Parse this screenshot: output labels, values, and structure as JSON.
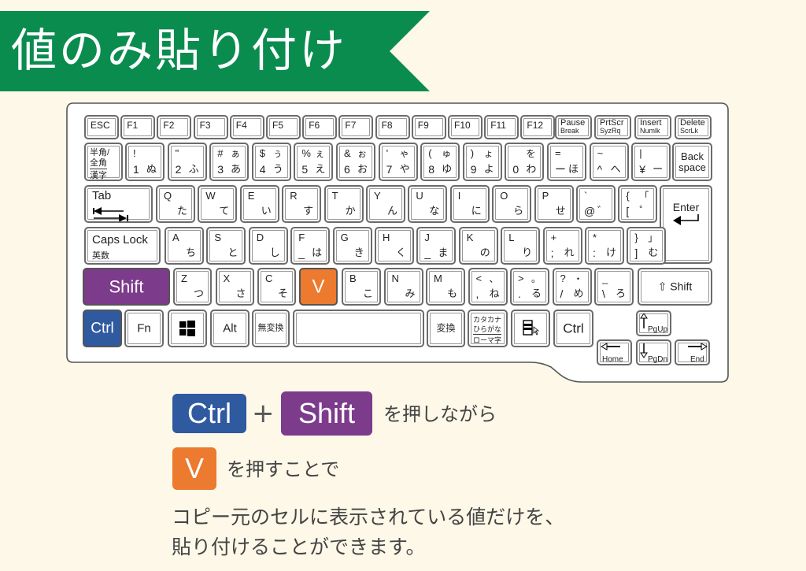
{
  "title": "値のみ貼り付け",
  "colors": {
    "banner": "#0a8c4f",
    "background": "#fdf8e8",
    "ctrl": "#2f5aa0",
    "shift": "#7d3b8c",
    "v": "#ec7a2f"
  },
  "keyboard": {
    "function_row": [
      "ESC",
      "F1",
      "F2",
      "F3",
      "F4",
      "F5",
      "F6",
      "F7",
      "F8",
      "F9",
      "F10",
      "F11",
      "F12"
    ],
    "pause": {
      "top": "Pause",
      "bottom": "Break"
    },
    "prtscr": {
      "top": "PrtScr",
      "bottom": "SyzRq"
    },
    "insert": {
      "top": "Insert",
      "bottom": "Numlk"
    },
    "delete": {
      "top": "Delete",
      "bottom": "ScrLk"
    },
    "hankaku": {
      "l1": "半角/",
      "l2": "全角",
      "l3": "漢字"
    },
    "number_row": [
      {
        "tl": "!",
        "tr": "",
        "bl": "1",
        "br": "ぬ"
      },
      {
        "tl": "\"",
        "tr": "",
        "bl": "2",
        "br": "ふ"
      },
      {
        "tl": "#",
        "tr": "ぁ",
        "bl": "3",
        "br": "あ"
      },
      {
        "tl": "$",
        "tr": "ぅ",
        "bl": "4",
        "br": "う"
      },
      {
        "tl": "%",
        "tr": "ぇ",
        "bl": "5",
        "br": "え"
      },
      {
        "tl": "&",
        "tr": "ぉ",
        "bl": "6",
        "br": "お"
      },
      {
        "tl": "'",
        "tr": "ゃ",
        "bl": "7",
        "br": "や"
      },
      {
        "tl": "(",
        "tr": "ゅ",
        "bl": "8",
        "br": "ゆ"
      },
      {
        "tl": ")",
        "tr": "ょ",
        "bl": "9",
        "br": "よ"
      },
      {
        "tl": "",
        "tr": "を",
        "bl": "0",
        "br": "わ"
      },
      {
        "tl": "=",
        "tr": "",
        "bl": "ー",
        "br": "ほ"
      },
      {
        "tl": "~",
        "tr": "",
        "bl": "^",
        "br": "へ"
      },
      {
        "tl": "|",
        "tr": "",
        "bl": "¥",
        "br": "ー"
      }
    ],
    "backspace": {
      "l1": "Back",
      "l2": "space"
    },
    "tab": "Tab",
    "q_row": [
      {
        "tl": "Q",
        "br": "た"
      },
      {
        "tl": "W",
        "br": "て"
      },
      {
        "tl": "E",
        "br": "い"
      },
      {
        "tl": "R",
        "br": "す"
      },
      {
        "tl": "T",
        "br": "か"
      },
      {
        "tl": "Y",
        "br": "ん"
      },
      {
        "tl": "U",
        "br": "な"
      },
      {
        "tl": "I",
        "br": "に"
      },
      {
        "tl": "O",
        "br": "ら"
      },
      {
        "tl": "P",
        "br": "せ"
      },
      {
        "tl": "`",
        "tr": "",
        "bl": "@",
        "br": "゛"
      },
      {
        "tl": "{",
        "tr": "「",
        "bl": "[",
        "br": "゜"
      }
    ],
    "enter": "Enter",
    "caps": {
      "l1": "Caps Lock",
      "l2": "英数"
    },
    "a_row": [
      {
        "tl": "A",
        "br": "ち"
      },
      {
        "tl": "S",
        "br": "と"
      },
      {
        "tl": "D",
        "br": "し"
      },
      {
        "tl": "F",
        "bl": "_",
        "br": "は"
      },
      {
        "tl": "G",
        "br": "き"
      },
      {
        "tl": "H",
        "br": "く"
      },
      {
        "tl": "J",
        "bl": "_",
        "br": "ま"
      },
      {
        "tl": "K",
        "br": "の"
      },
      {
        "tl": "L",
        "br": "り"
      },
      {
        "tl": "+",
        "tr": "",
        "bl": ";",
        "br": "れ"
      },
      {
        "tl": "*",
        "tr": "",
        "bl": ":",
        "br": "け"
      },
      {
        "tl": "}",
        "tr": "」",
        "bl": "]",
        "br": "む"
      }
    ],
    "shift_left": "Shift",
    "z_row": [
      {
        "tl": "Z",
        "br": "つ"
      },
      {
        "tl": "X",
        "br": "さ"
      },
      {
        "tl": "C",
        "br": "そ"
      }
    ],
    "v_key": "V",
    "z_row2": [
      {
        "tl": "B",
        "br": "こ"
      },
      {
        "tl": "N",
        "br": "み"
      },
      {
        "tl": "M",
        "br": "も"
      },
      {
        "tl": "<",
        "tr": "、",
        "bl": ",",
        "br": "ね"
      },
      {
        "tl": ">",
        "tr": "。",
        "bl": ".",
        "br": "る"
      },
      {
        "tl": "?",
        "tr": "・",
        "bl": "/",
        "br": "め"
      },
      {
        "tl": "_",
        "tr": "",
        "bl": "\\",
        "br": "ろ"
      }
    ],
    "shift_right": "Shift",
    "ctrl_left": "Ctrl",
    "fn": "Fn",
    "alt": "Alt",
    "muhenkan": "無変換",
    "henkan": "変換",
    "kana": {
      "l1": "カタカナ",
      "l2": "ひらがな",
      "l3": "ローマ字"
    },
    "ctrl_right": "Ctrl",
    "pgup": "PgUp",
    "home": "Home",
    "pgdn": "PgDn",
    "end": "End"
  },
  "instructions": {
    "ctrl": "Ctrl",
    "plus": "+",
    "shift": "Shift",
    "line1_suffix": "を押しながら",
    "v": "V",
    "line2_suffix": "を押すことで",
    "desc1": "コピー元のセルに表示されている値だけを、",
    "desc2": "貼り付けることができます。"
  }
}
